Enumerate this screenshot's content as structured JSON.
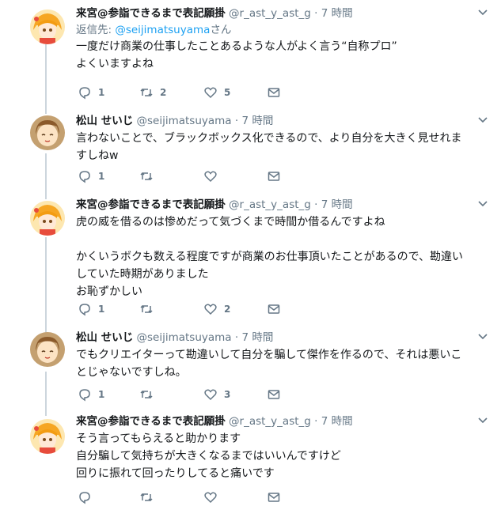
{
  "tweets": [
    {
      "name": "来宮@参詣できるまで表記願掛",
      "handle": "@r_ast_y_ast_g",
      "sep": "·",
      "time": "7 時間",
      "reply_prefix": "返信先: ",
      "reply_handle": "@seijimatsuyama",
      "reply_suffix": "さん",
      "text": "一度だけ商業の仕事したことあるような人がよく言う“自称プロ”\nよくいますよね",
      "counts": {
        "reply": "1",
        "retweet": "2",
        "like": "5"
      }
    },
    {
      "name": "松山 せいじ",
      "handle": "@seijimatsuyama",
      "sep": "·",
      "time": "7 時間",
      "text": "言わないことで、ブラックボックス化できるので、より自分を大きく見せれま\nすしねw",
      "counts": {
        "reply": "1",
        "retweet": "",
        "like": ""
      }
    },
    {
      "name": "来宮@参詣できるまで表記願掛",
      "handle": "@r_ast_y_ast_g",
      "sep": "·",
      "time": "7 時間",
      "text": "虎の威を借るのは惨めだって気づくまで時間か借るんですよね\n\nかくいうボクも数える程度ですが商業のお仕事頂いたことがあるので、勘違い\nしていた時期がありました\nお恥ずかしい",
      "counts": {
        "reply": "1",
        "retweet": "",
        "like": "2"
      }
    },
    {
      "name": "松山 せいじ",
      "handle": "@seijimatsuyama",
      "sep": "·",
      "time": "7 時間",
      "text": "でもクリエイターって勘違いして自分を騙して傑作を作るので、それは悪いこ\nとじゃないですしね。",
      "counts": {
        "reply": "1",
        "retweet": "",
        "like": "3"
      }
    },
    {
      "name": "来宮@参詣できるまで表記願掛",
      "handle": "@r_ast_y_ast_g",
      "sep": "·",
      "time": "7 時間",
      "text": "そう言ってもらえると助かります\n自分騙して気持ちが大きくなるまではいいんですけど\n回りに振れて回ったりしてると痛いです",
      "counts": {
        "reply": "",
        "retweet": "",
        "like": ""
      }
    }
  ],
  "colors": {
    "text": "#14171a",
    "secondary": "#657786",
    "link": "#1da1f2",
    "thread_line": "#ccd6dd"
  }
}
